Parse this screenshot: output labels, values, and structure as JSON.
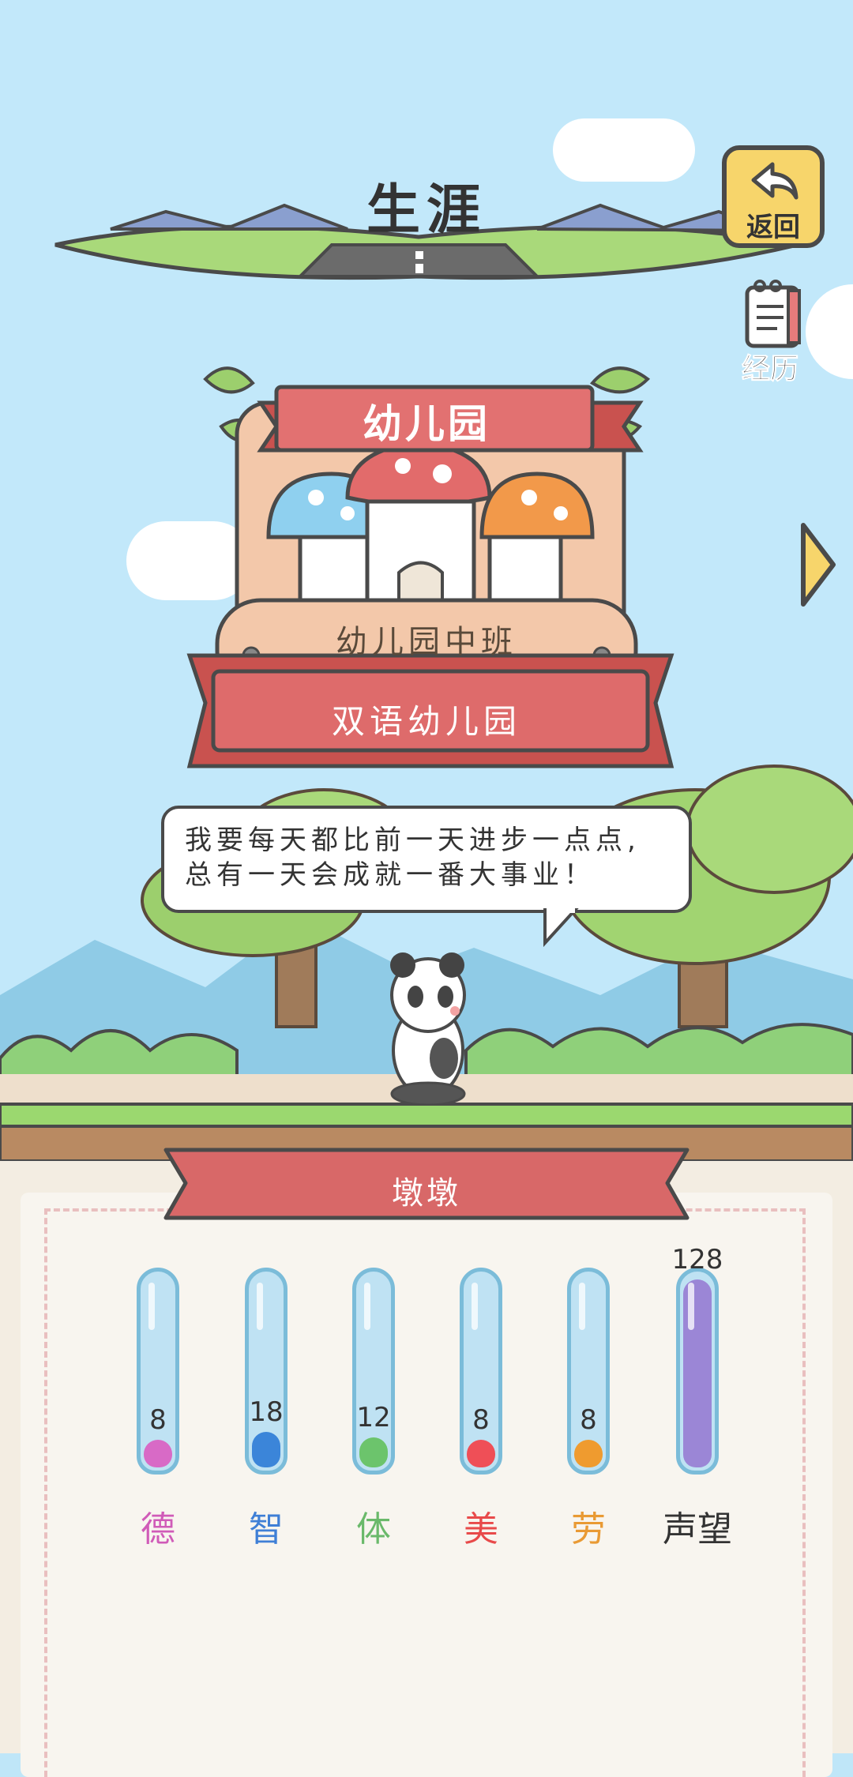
{
  "header": {
    "title": "生涯",
    "back_label": "返回",
    "history_label": "经历"
  },
  "stage": {
    "badge_title": "幼儿园",
    "plaque": "幼儿园中班",
    "school": "双语幼儿园"
  },
  "dialogue": {
    "line1": "我要每天都比前一天进步一点点,",
    "line2": "总有一天会成就一番大事业！"
  },
  "character": {
    "name": "墩墩"
  },
  "stats": [
    {
      "label": "德",
      "value": "8",
      "level": 0.14,
      "color": "#d05bb8",
      "fill": "#d86ac6"
    },
    {
      "label": "智",
      "value": "18",
      "level": 0.18,
      "color": "#3f7fd6",
      "fill": "#3b85d9"
    },
    {
      "label": "体",
      "value": "12",
      "level": 0.15,
      "color": "#6ab96a",
      "fill": "#6cc46c"
    },
    {
      "label": "美",
      "value": "8",
      "level": 0.14,
      "color": "#e84a4a",
      "fill": "#ef4f57"
    },
    {
      "label": "劳",
      "value": "8",
      "level": 0.14,
      "color": "#e99a34",
      "fill": "#ef9b2f"
    },
    {
      "label": "声望",
      "value": "128",
      "level": 0.95,
      "color": "#333333",
      "fill": "#9b86d6"
    }
  ]
}
